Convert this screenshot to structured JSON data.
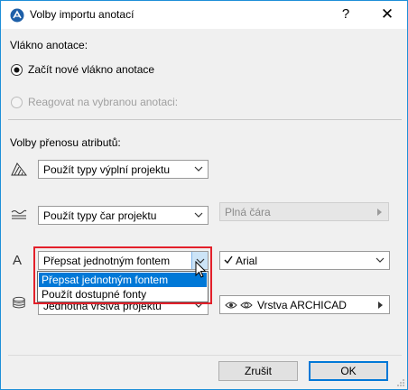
{
  "window": {
    "title": "Volby importu anotací",
    "help": "?",
    "close": "✕"
  },
  "section_thread": {
    "heading": "Vlákno anotace:",
    "option_new": "Začít nové vlákno anotace",
    "option_reply": "Reagovat na vybranou anotaci:"
  },
  "section_attributes": {
    "heading": "Volby přenosu atributů:",
    "fill": {
      "value": "Použít typy výplní projektu"
    },
    "line": {
      "value": "Použít typy čar projektu",
      "linetype": "Plná čára"
    },
    "font": {
      "value": "Přepsat jednotným fontem",
      "font_value": "Arial",
      "options": [
        "Přepsat jednotným fontem",
        "Použít dostupné fonty"
      ]
    },
    "layer": {
      "value": "Jednotná vrstva projektu",
      "layer_value": "Vrstva ARCHICAD"
    }
  },
  "buttons": {
    "cancel": "Zrušit",
    "ok": "OK"
  },
  "colors": {
    "accent": "#0078d7",
    "highlight_frame": "#e3202a",
    "window_border": "#1e8fd8"
  }
}
